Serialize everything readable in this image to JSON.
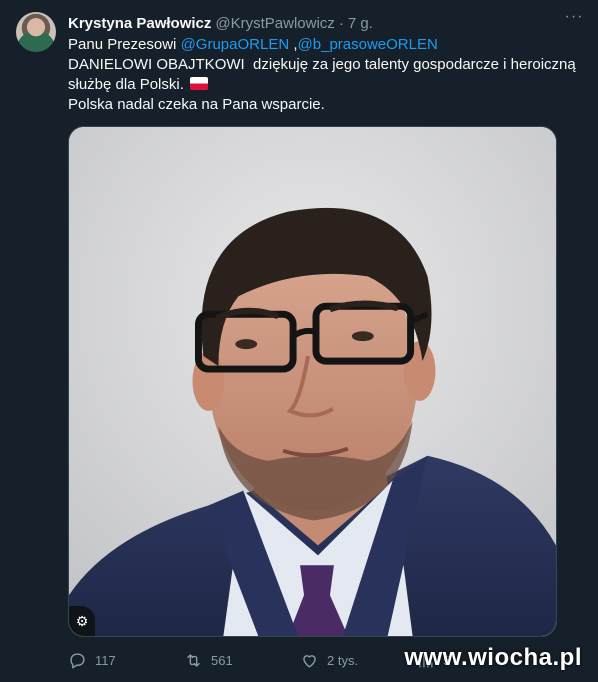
{
  "author": {
    "name": "Krystyna Pawłowicz",
    "handle": "@KrystPawlowicz",
    "separator": "·",
    "time": "7 g."
  },
  "more_label": "···",
  "text": {
    "line1_prefix": "Panu Prezesowi",
    "mention1": "@GrupaORLEN",
    "mention_sep": ",",
    "mention2": "@b_prasoweORLEN",
    "line2": "DANIELOWI OBAJTKOWI  dziękuję za jego talenty gospodarcze i heroiczną",
    "line3": "służbę dla Polski.",
    "line4": "Polska nadal czeka na Pana wsparcie."
  },
  "actions": {
    "reply_count": "117",
    "retweet_count": "561",
    "like_count": "2 tys.",
    "views_count": "5"
  },
  "watermark": "www.wiocha.pl",
  "colors": {
    "background": "#15202b",
    "text": "#f7f9f9",
    "secondary": "#8b98a5",
    "link": "#1d9bf0"
  }
}
